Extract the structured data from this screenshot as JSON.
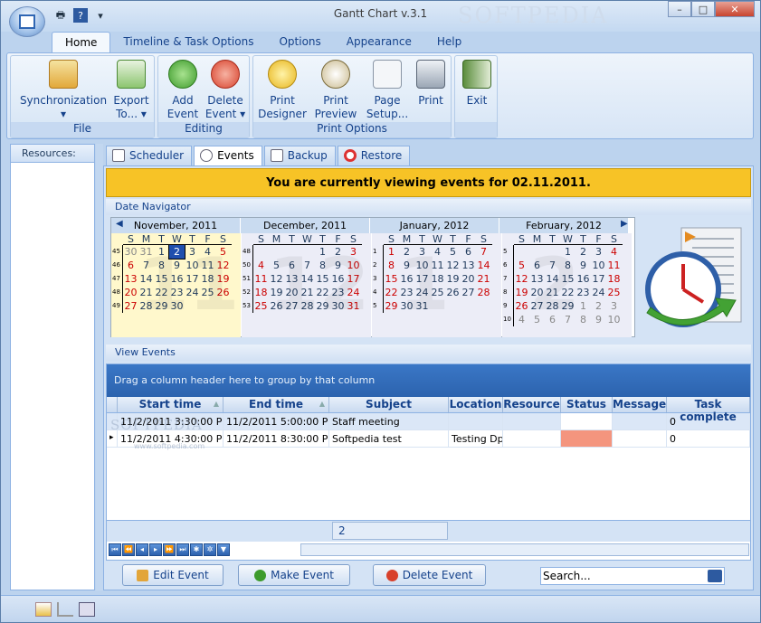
{
  "window": {
    "title": "Gantt Chart v.3.1",
    "watermark": "SOFTPEDIA",
    "grid_watermark": "SOFTPEDIA",
    "grid_watermark_sub": "www.softpedia.com",
    "min": "–",
    "max": "□",
    "close": "✕"
  },
  "qat": {
    "print": "🖶",
    "help": "?",
    "more": "▾"
  },
  "tabs": [
    {
      "label": "Home"
    },
    {
      "label": "Timeline & Task Options"
    },
    {
      "label": "Options"
    },
    {
      "label": "Appearance"
    },
    {
      "label": "Help"
    }
  ],
  "ribbon": {
    "groups": [
      {
        "label": "File"
      },
      {
        "label": "Editing"
      },
      {
        "label": "Print Options"
      },
      {
        "label": ""
      }
    ],
    "buttons": [
      {
        "l1": "Synchronization",
        "l2": "▾"
      },
      {
        "l1": "Export",
        "l2": "To... ▾"
      },
      {
        "l1": "Add",
        "l2": "Event"
      },
      {
        "l1": "Delete",
        "l2": "Event ▾"
      },
      {
        "l1": "Print",
        "l2": "Designer"
      },
      {
        "l1": "Print",
        "l2": "Preview"
      },
      {
        "l1": "Page",
        "l2": "Setup..."
      },
      {
        "l1": "Print",
        "l2": ""
      },
      {
        "l1": "Exit",
        "l2": ""
      }
    ]
  },
  "resources_label": "Resources:",
  "content_tabs": [
    {
      "label": "Scheduler"
    },
    {
      "label": "Events"
    },
    {
      "label": "Backup"
    },
    {
      "label": "Restore"
    }
  ],
  "banner": "You are currently viewing events for 02.11.2011.",
  "date_nav_label": "Date Navigator",
  "calendar": {
    "dow": [
      "S",
      "M",
      "T",
      "W",
      "T",
      "F",
      "S"
    ],
    "months": [
      {
        "name": "November, 2011",
        "big": "11",
        "weeks": [
          {
            "wk": "45",
            "days": [
              "30",
              "31",
              "1",
              "2",
              "3",
              "4",
              "5"
            ]
          },
          {
            "wk": "46",
            "days": [
              "6",
              "7",
              "8",
              "9",
              "10",
              "11",
              "12"
            ]
          },
          {
            "wk": "47",
            "days": [
              "13",
              "14",
              "15",
              "16",
              "17",
              "18",
              "19"
            ]
          },
          {
            "wk": "48",
            "days": [
              "20",
              "21",
              "22",
              "23",
              "24",
              "25",
              "26"
            ]
          },
          {
            "wk": "49",
            "days": [
              "27",
              "28",
              "29",
              "30",
              "",
              "",
              ""
            ]
          }
        ]
      },
      {
        "name": "December, 2011",
        "big": "12",
        "weeks": [
          {
            "wk": "48",
            "days": [
              "",
              "",
              "",
              "",
              "1",
              "2",
              "3"
            ]
          },
          {
            "wk": "50",
            "days": [
              "4",
              "5",
              "6",
              "7",
              "8",
              "9",
              "10"
            ]
          },
          {
            "wk": "51",
            "days": [
              "11",
              "12",
              "13",
              "14",
              "15",
              "16",
              "17"
            ]
          },
          {
            "wk": "52",
            "days": [
              "18",
              "19",
              "20",
              "21",
              "22",
              "23",
              "24"
            ]
          },
          {
            "wk": "53",
            "days": [
              "25",
              "26",
              "27",
              "28",
              "29",
              "30",
              "31"
            ]
          }
        ]
      },
      {
        "name": "January, 2012",
        "big": "1",
        "weeks": [
          {
            "wk": "1",
            "days": [
              "1",
              "2",
              "3",
              "4",
              "5",
              "6",
              "7"
            ]
          },
          {
            "wk": "2",
            "days": [
              "8",
              "9",
              "10",
              "11",
              "12",
              "13",
              "14"
            ]
          },
          {
            "wk": "3",
            "days": [
              "15",
              "16",
              "17",
              "18",
              "19",
              "20",
              "21"
            ]
          },
          {
            "wk": "4",
            "days": [
              "22",
              "23",
              "24",
              "25",
              "26",
              "27",
              "28"
            ]
          },
          {
            "wk": "5",
            "days": [
              "29",
              "30",
              "31",
              "",
              "",
              "",
              ""
            ]
          }
        ]
      },
      {
        "name": "February, 2012",
        "big": "2",
        "weeks": [
          {
            "wk": "5",
            "days": [
              "",
              "",
              "",
              "1",
              "2",
              "3",
              "4"
            ]
          },
          {
            "wk": "6",
            "days": [
              "5",
              "6",
              "7",
              "8",
              "9",
              "10",
              "11"
            ]
          },
          {
            "wk": "7",
            "days": [
              "12",
              "13",
              "14",
              "15",
              "16",
              "17",
              "18"
            ]
          },
          {
            "wk": "8",
            "days": [
              "19",
              "20",
              "21",
              "22",
              "23",
              "24",
              "25"
            ]
          },
          {
            "wk": "9",
            "days": [
              "26",
              "27",
              "28",
              "29",
              "1",
              "2",
              "3"
            ]
          },
          {
            "wk": "10",
            "days": [
              "4",
              "5",
              "6",
              "7",
              "8",
              "9",
              "10"
            ]
          }
        ]
      }
    ],
    "nav_prev": "◀",
    "nav_next": "▶"
  },
  "view_events_label": "View Events",
  "grid": {
    "group_hint": "Drag a column header here to group by that column",
    "columns": [
      "Start time",
      "End time",
      "Subject",
      "Location",
      "Resource",
      "Status",
      "Message",
      "Task complete"
    ],
    "sort_arrow": "▲",
    "rows": [
      {
        "marker": "",
        "start": "11/2/2011 3:30:00 PM",
        "end": "11/2/2011 5:00:00 PM",
        "subject": "Staff meeting",
        "location": "",
        "resource": "",
        "status": "",
        "message": "",
        "complete": "0"
      },
      {
        "marker": "▸",
        "start": "11/2/2011 4:30:00 PM",
        "end": "11/2/2011 8:30:00 PM",
        "subject": "Softpedia test",
        "location": "Testing Dpt",
        "resource": "",
        "status": "",
        "message": "",
        "complete": "0"
      }
    ],
    "footer_count": "2",
    "status_color": "#f4957e"
  },
  "buttons": {
    "edit": "Edit Event",
    "make": "Make Event",
    "delete": "Delete Event"
  },
  "search": {
    "placeholder": "Search..."
  }
}
